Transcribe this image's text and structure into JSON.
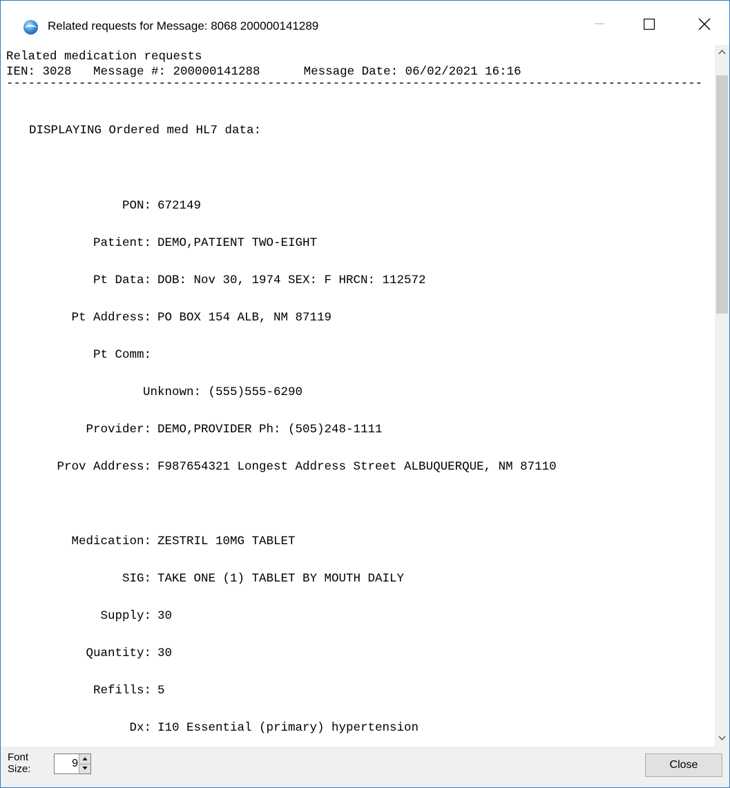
{
  "window": {
    "title": "Related requests for Message: 8068 200000141289"
  },
  "header": {
    "line1": "Related medication requests",
    "line2": "IEN: 3028   Message #: 200000141288      Message Date: 06/02/2021 16:16"
  },
  "body": {
    "heading": "DISPLAYING Ordered med HL7 data:",
    "fields": [
      {
        "label": "PON:",
        "value": "672149"
      },
      {
        "label": "Patient:",
        "value": "DEMO,PATIENT TWO-EIGHT"
      },
      {
        "label": "Pt Data:",
        "value": "DOB: Nov 30, 1974 SEX: F HRCN: 112572"
      },
      {
        "label": "Pt Address:",
        "value": "PO BOX 154 ALB, NM 87119"
      },
      {
        "label": "Pt Comm:",
        "value": ""
      },
      {
        "label": "",
        "value": "Unknown: (555)555-6290"
      },
      {
        "label": "Provider:",
        "value": "DEMO,PROVIDER Ph: (505)248-1111"
      },
      {
        "label": "Prov Address:",
        "value": "F987654321 Longest Address Street ALBUQUERQUE, NM 87110"
      },
      {
        "label": "Medication:",
        "value": "ZESTRIL 10MG TABLET"
      },
      {
        "label": "SIG:",
        "value": "TAKE ONE (1) TABLET BY MOUTH DAILY"
      },
      {
        "label": "Supply:",
        "value": "30"
      },
      {
        "label": "Quantity:",
        "value": "30"
      },
      {
        "label": "Refills:",
        "value": "5"
      },
      {
        "label": "Dx:",
        "value": "I10 Essential (primary) hypertension"
      }
    ]
  },
  "footer": {
    "font_size_label": "Font Size:",
    "font_size_value": "9",
    "close_label": "Close"
  }
}
